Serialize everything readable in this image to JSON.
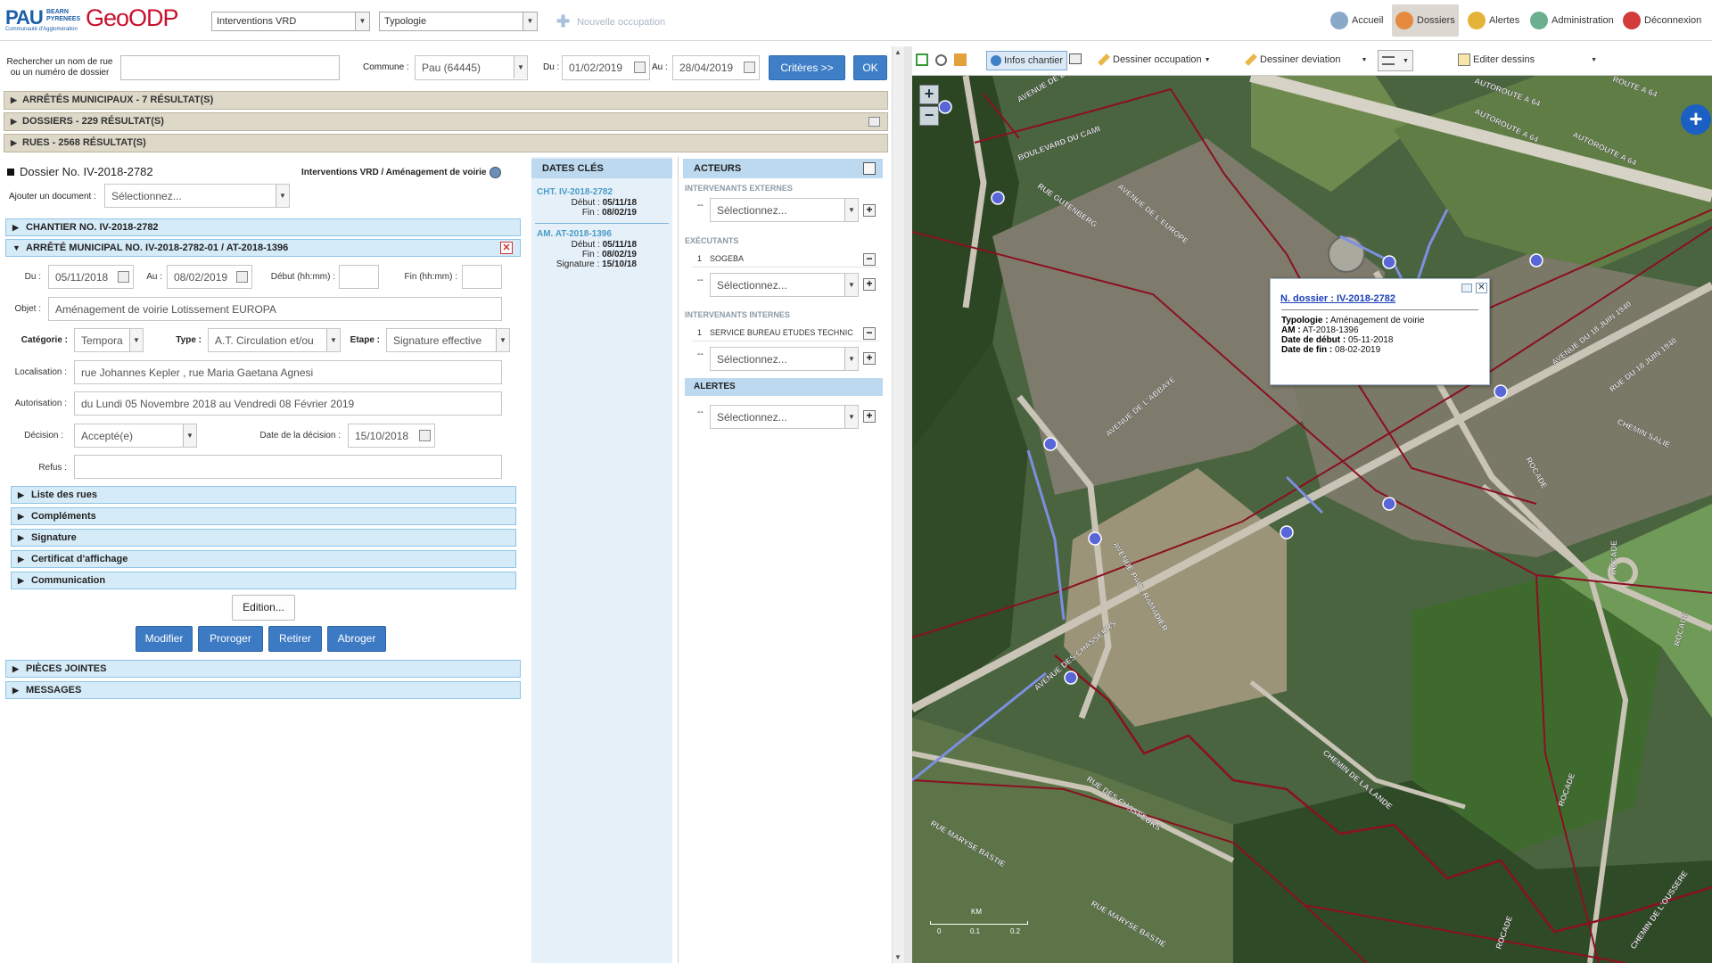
{
  "header": {
    "logo_pau": "PAU",
    "logo_bearn": "BEARN PYRENEES",
    "logo_sub": "Communauté d'Agglomération",
    "logo_geo": "GeoODP",
    "select_category": "Interventions VRD",
    "select_typologie": "Typologie",
    "new_occupation": "Nouvelle occupation",
    "nav": [
      "Accueil",
      "Dossiers",
      "Alertes",
      "Administration",
      "Déconnexion"
    ]
  },
  "search": {
    "label": "Rechercher un nom de rue ou un numéro de dossier",
    "value": "",
    "commune_label": "Commune :",
    "commune_value": "Pau (64445)",
    "du_label": "Du :",
    "du_value": "01/02/2019",
    "au_label": "Au :",
    "au_value": "28/04/2019",
    "criteria_button": "Critères >>",
    "ok_button": "OK"
  },
  "results": [
    {
      "label": "ARRÊTÉS MUNICIPAUX - 7 RÉSULTAT(S)"
    },
    {
      "label": "DOSSIERS - 229 RÉSULTAT(S)"
    },
    {
      "label": "RUES - 2568 RÉSULTAT(S)"
    }
  ],
  "dossier": {
    "title": "Dossier No. IV-2018-2782",
    "category": "Interventions VRD / Aménagement de voirie",
    "add_doc_label": "Ajouter un document :",
    "add_doc_value": "Sélectionnez...",
    "chantier": "CHANTIER NO. IV-2018-2782",
    "arrete": "ARRÊTÉ MUNICIPAL NO. IV-2018-2782-01 / AT-2018-1396"
  },
  "form": {
    "du_label": "Du :",
    "du_value": "05/11/2018",
    "au_label": "Au :",
    "au_value": "08/02/2019",
    "debut_label": "Début (hh:mm) :",
    "debut_value": "",
    "fin_label": "Fin (hh:mm) :",
    "fin_value": "",
    "objet_label": "Objet :",
    "objet_value": "Aménagement de voirie Lotissement EUROPA",
    "categorie_label": "Catégorie :",
    "categorie_value": "Tempora",
    "type_label": "Type :",
    "type_value": "A.T. Circulation et/ou",
    "etape_label": "Etape :",
    "etape_value": "Signature effective",
    "localisation_label": "Localisation :",
    "localisation_value": "rue Johannes Kepler ,  rue Maria Gaetana Agnesi",
    "autorisation_label": "Autorisation :",
    "autorisation_value": "du Lundi 05 Novembre 2018 au Vendredi 08 Février 2019",
    "decision_label": "Décision :",
    "decision_value": "Accepté(e)",
    "date_decision_label": "Date de la décision :",
    "date_decision_value": "15/10/2018",
    "refus_label": "Refus :",
    "refus_value": ""
  },
  "subsections": [
    "Liste des rues",
    "Compléments",
    "Signature",
    "Certificat d'affichage",
    "Communication"
  ],
  "edition_button": "Edition...",
  "actions": [
    "Modifier",
    "Proroger",
    "Retirer",
    "Abroger"
  ],
  "bottom_sections": [
    "PIÈCES JOINTES",
    "MESSAGES"
  ],
  "dates_cles": {
    "title": "DATES CLÉS",
    "items": [
      {
        "ref": "CHT. IV-2018-2782",
        "rows": [
          [
            "Début :",
            "05/11/18"
          ],
          [
            "Fin :",
            "08/02/19"
          ]
        ]
      },
      {
        "ref": "AM. AT-2018-1396",
        "rows": [
          [
            "Début :",
            "05/11/18"
          ],
          [
            "Fin :",
            "08/02/19"
          ],
          [
            "Signature :",
            "15/10/18"
          ]
        ]
      }
    ]
  },
  "acteurs": {
    "title": "ACTEURS",
    "ext_title": "INTERVENANTS EXTERNES",
    "exec_title": "EXÉCUTANTS",
    "exec_item": "SOGEBA",
    "exec_num": "1",
    "int_title": "INTERVENANTS INTERNES",
    "int_item": "SERVICE BUREAU ETUDES TECHNIC",
    "int_num": "1",
    "alertes_title": "ALERTES",
    "select_placeholder": "Sélectionnez...",
    "dash": "--"
  },
  "map_toolbar": {
    "infos": "Infos chantier",
    "dessiner_occ": "Dessiner occupation",
    "dessiner_dev": "Dessiner deviation",
    "editer": "Editer dessins"
  },
  "popup": {
    "link": "N. dossier : IV-2018-2782",
    "typologie_label": "Typologie :",
    "typologie_value": "Aménagement de voirie",
    "am_label": "AM :",
    "am_value": "AT-2018-1396",
    "debut_label": "Date de début :",
    "debut_value": "05-11-2018",
    "fin_label": "Date de fin :",
    "fin_value": "08-02-2019"
  },
  "map_labels": [
    "AVENUE DE L'EUROPE",
    "BOULEVARD DU CAMI",
    "RUE GUTENBERG",
    "AVENUE DE L'EUROPE",
    "AUTOROUTE A 64",
    "AUTOROUTE A 64",
    "AUTOROUTE A 64",
    "ROUTE A 64",
    "AVENUE DU 18 JUIN 1940",
    "RUE DU 18 JUIN 1940",
    "CHEMIN SALIE",
    "ROCADE",
    "AVENUE DE L'ABBAYE",
    "AVENUE PAUL RAMADIER",
    "AVENUE DES CHASSEURS",
    "RUE DES CHASSEURS",
    "CHEMIN DE LA LANDE",
    "RUE MARYSE BASTIE",
    "RUE MARYSE BASTIE",
    "ROCADE",
    "ROCADE",
    "CHEMIN DE L'OUSSERE",
    "ROCADE",
    "ROCADE"
  ],
  "scale": {
    "a": "0",
    "b": "0.1",
    "c": "0.2",
    "unit": "KM"
  },
  "colors": {
    "accent": "#3f7fc7",
    "section": "#d6ebf8",
    "result": "#ddd8c8",
    "route": "#8b1020"
  }
}
